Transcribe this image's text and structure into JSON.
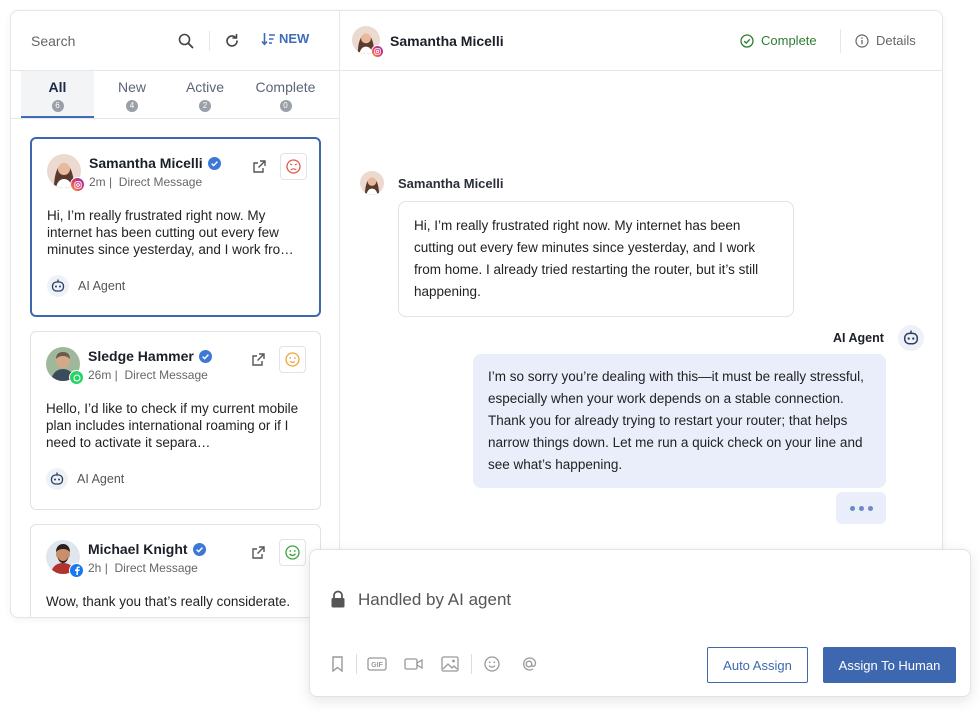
{
  "search": {
    "label": "Search"
  },
  "toolbar": {
    "new_label": "NEW"
  },
  "tabs": [
    {
      "label": "All",
      "count": "6",
      "active": true
    },
    {
      "label": "New",
      "count": "4"
    },
    {
      "label": "Active",
      "count": "2"
    },
    {
      "label": "Complete",
      "count": "0"
    }
  ],
  "conversations": [
    {
      "name": "Samantha Micelli",
      "time": "2m",
      "channel": "Direct Message",
      "platform": "instagram-icon",
      "sentiment": "frustrated-face-icon",
      "sentiment_color": "#e05a4b",
      "preview": "Hi, I’m really frustrated right now. My internet has been cutting out every few minutes since yesterday, and I work fro…",
      "agent": "AI Agent"
    },
    {
      "name": "Sledge Hammer",
      "time": "26m",
      "channel": "Direct Message",
      "platform": "whatsapp-icon",
      "sentiment": "neutral-face-icon",
      "sentiment_color": "#f0a33a",
      "preview": "Hello, I’d like to check if my current mobile plan includes international roaming or if I need to activate it separa…",
      "agent": "AI Agent"
    },
    {
      "name": "Michael Knight",
      "time": "2h",
      "channel": "Direct Message",
      "platform": "facebook-icon",
      "sentiment": "happy-face-icon",
      "sentiment_color": "#3aa33e",
      "preview": "Wow, thank you that’s really considerate."
    }
  ],
  "header": {
    "contact_name": "Samantha Micelli",
    "complete_label": "Complete",
    "details_label": "Details"
  },
  "messages": {
    "incoming_sender": "Samantha Micelli",
    "incoming_text": "Hi, I’m really frustrated right now. My internet has been cutting out every few minutes since yesterday, and I work from home. I already tried restarting the router, but it’s still happening.",
    "agent_sender": "AI Agent",
    "agent_text": "I’m so sorry you’re dealing with this—it must be really stressful, especially when your work depends on a stable connection. Thank you for already trying to restart your router; that helps narrow things down. Let me run a quick check on your line and see what’s happening."
  },
  "composer": {
    "status": "Handled by AI agent",
    "auto_assign_label": "Auto Assign",
    "assign_human_label": "Assign To Human",
    "gif_label": "GIF"
  },
  "colors": {
    "accent": "#3d68b0",
    "complete": "#2e7d32",
    "agent_bubble": "#e9eefa"
  }
}
